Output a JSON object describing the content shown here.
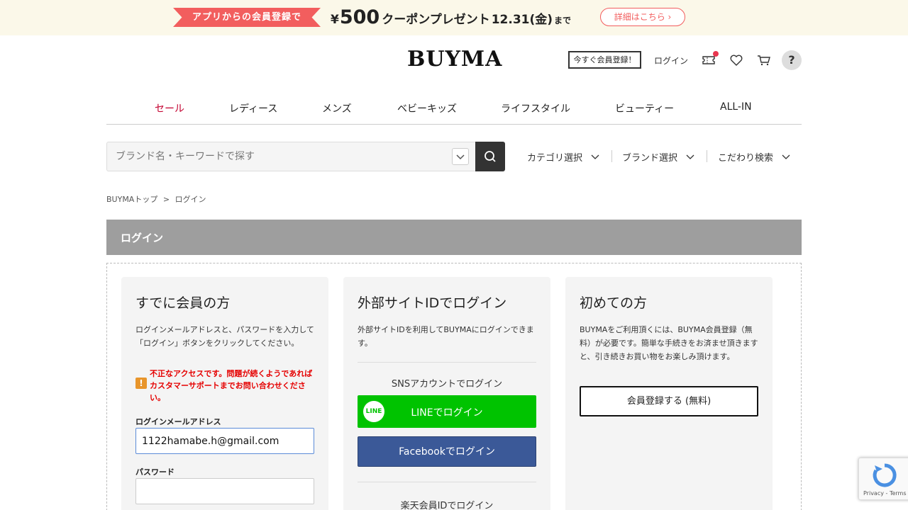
{
  "banner": {
    "tag": "アプリからの会員登録で",
    "yen": "¥",
    "amount": "500",
    "rest": "クーポンプレゼント",
    "date": "12.31(金)",
    "until": "まで",
    "details": "詳細はこちら ›"
  },
  "header": {
    "logo": "BUYMA",
    "register": "今すぐ会員登録！",
    "login": "ログイン",
    "help": "?"
  },
  "nav": [
    {
      "label": "セール"
    },
    {
      "label": "レディース"
    },
    {
      "label": "メンズ"
    },
    {
      "label": "ベビーキッズ"
    },
    {
      "label": "ライフスタイル"
    },
    {
      "label": "ビューティー"
    },
    {
      "label": "ALL-IN"
    }
  ],
  "search": {
    "placeholder": "ブランド名・キーワードで探す",
    "filters": [
      "カテゴリ選択",
      "ブランド選択",
      "こだわり検索"
    ]
  },
  "breadcrumb": [
    "BUYMAトップ",
    ">",
    "ログイン"
  ],
  "page_title": "ログイン",
  "member": {
    "title": "すでに会員の方",
    "desc": "ログインメールアドレスと、パスワードを入力して「ログイン」ボタンをクリックしてください。",
    "error": "不正なアクセスです。問題が続くようであればカスタマーサポートまでお問い合わせください。",
    "email_label": "ログインメールアドレス",
    "email_value": "1122hamabe.h@gmail.com",
    "password_label": "パスワード",
    "password_value": ""
  },
  "external": {
    "title": "外部サイトIDでログイン",
    "desc": "外部サイトIDを利用してBUYMAにログインできます。",
    "sns_head": "SNSアカウントでログイン",
    "line_logo": "LINE",
    "line_button": "LINEでログイン",
    "facebook_button": "Facebookでログイン",
    "rakuten_head": "楽天会員IDでログイン"
  },
  "newuser": {
    "title": "初めての方",
    "desc": "BUYMAをご利用頂くには、BUYMA会員登録（無料）が必要です。簡単な手続きをお済ませ頂きますと、引き続きお買い物をお楽しみ頂けます。",
    "register_button": "会員登録する (無料)"
  },
  "recaptcha": {
    "links": "Privacy - Terms"
  }
}
